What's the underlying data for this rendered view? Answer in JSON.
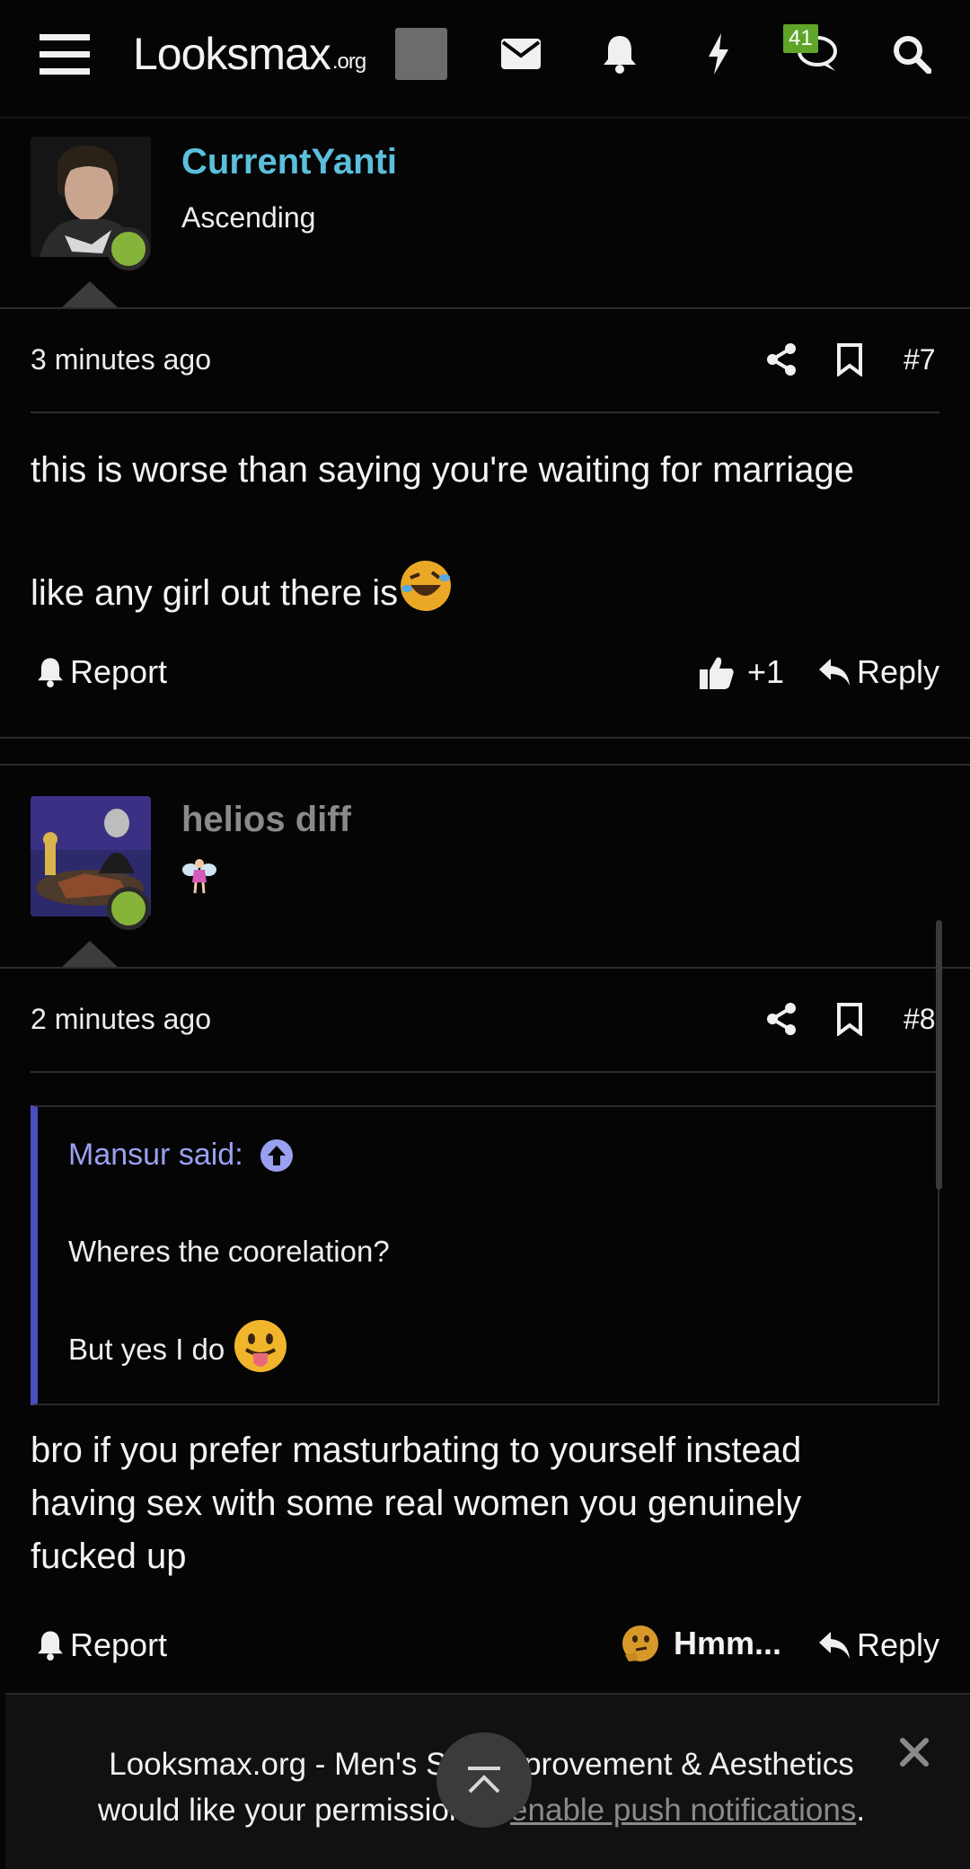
{
  "header": {
    "logo_main": "Looksmax",
    "logo_suffix": ".org",
    "chat_badge": "41",
    "icons": [
      "hamburger-icon",
      "envelope-icon",
      "bell-icon",
      "bolt-icon",
      "chat-icon",
      "search-icon"
    ]
  },
  "posts": [
    {
      "username": "CurrentYanti",
      "username_color": "#5bbfdc",
      "user_title": "Ascending",
      "time": "3 minutes ago",
      "post_number": "#7",
      "lines": [
        "this is worse than saying you're waiting for marriage",
        "like any girl out there is"
      ],
      "emoji": "rofl-emoji",
      "report_label": "Report",
      "reaction_label": "+1",
      "reply_label": "Reply"
    },
    {
      "username": "helios diff",
      "username_color": "#8a8a8a",
      "user_title_icon": "fairy-emoji",
      "time": "2 minutes ago",
      "post_number": "#8",
      "quote": {
        "author": "Mansur said:",
        "line1": "Wheres the coorelation?",
        "line2": "But yes I do"
      },
      "lines": [
        "bro if you prefer masturbating to yourself instead",
        "having sex with some real women you genuinely",
        "fucked up"
      ],
      "report_label": "Report",
      "reaction_label": "Hmm...",
      "reply_label": "Reply"
    }
  ],
  "notification": {
    "text_line1": "Looksmax.org - Men's Self Improvement & Aesthetics",
    "text_line2_prefix": "would like your permission to",
    "link_label": "enable push notifications",
    "text_line2_suffix": "."
  }
}
